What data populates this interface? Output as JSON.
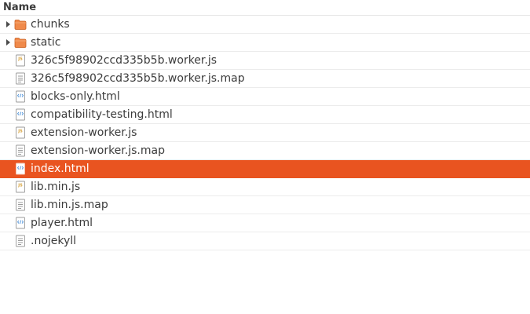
{
  "header": {
    "name_label": "Name"
  },
  "colors": {
    "selection": "#e95420",
    "folder": "#f08a4b",
    "js_badge": "#d8a23a",
    "html_badge": "#4a90d9"
  },
  "files": [
    {
      "name": "chunks",
      "type": "folder",
      "icon": "folder-icon",
      "selected": false
    },
    {
      "name": "static",
      "type": "folder",
      "icon": "folder-icon",
      "selected": false
    },
    {
      "name": "326c5f98902ccd335b5b.worker.js",
      "type": "js",
      "icon": "js-file-icon",
      "selected": false
    },
    {
      "name": "326c5f98902ccd335b5b.worker.js.map",
      "type": "text",
      "icon": "text-file-icon",
      "selected": false
    },
    {
      "name": "blocks-only.html",
      "type": "html",
      "icon": "html-file-icon",
      "selected": false
    },
    {
      "name": "compatibility-testing.html",
      "type": "html",
      "icon": "html-file-icon",
      "selected": false
    },
    {
      "name": "extension-worker.js",
      "type": "js",
      "icon": "js-file-icon",
      "selected": false
    },
    {
      "name": "extension-worker.js.map",
      "type": "text",
      "icon": "text-file-icon",
      "selected": false
    },
    {
      "name": "index.html",
      "type": "html",
      "icon": "html-file-icon",
      "selected": true
    },
    {
      "name": "lib.min.js",
      "type": "js",
      "icon": "js-file-icon",
      "selected": false
    },
    {
      "name": "lib.min.js.map",
      "type": "text",
      "icon": "text-file-icon",
      "selected": false
    },
    {
      "name": "player.html",
      "type": "html",
      "icon": "html-file-icon",
      "selected": false
    },
    {
      "name": ".nojekyll",
      "type": "text",
      "icon": "text-file-icon",
      "selected": false
    }
  ]
}
